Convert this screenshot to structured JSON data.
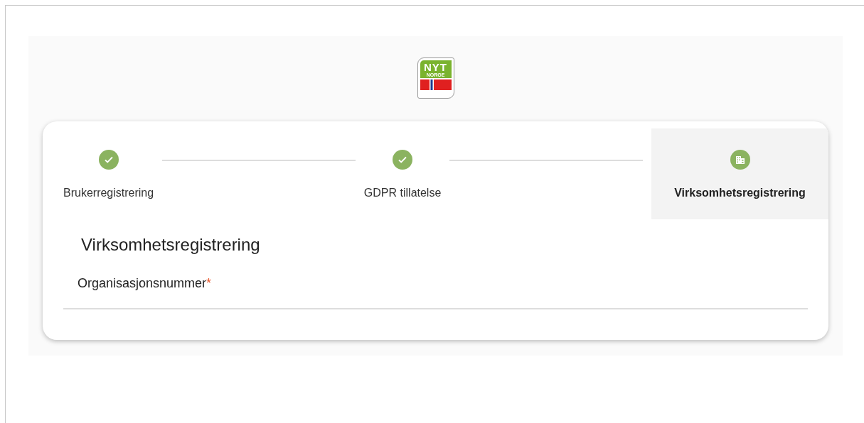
{
  "logo": {
    "line1": "NYT",
    "line2": "NORGE"
  },
  "steps": [
    {
      "label": "Brukerregistrering",
      "completed": true,
      "selected": false
    },
    {
      "label": "GDPR tillatelse",
      "completed": true,
      "selected": false
    },
    {
      "label": "Virksomhetsregistrering",
      "completed": false,
      "selected": true
    }
  ],
  "form": {
    "title": "Virksomhetsregistrering",
    "field": {
      "label": "Organisasjonsnummer",
      "required_mark": "*"
    }
  }
}
